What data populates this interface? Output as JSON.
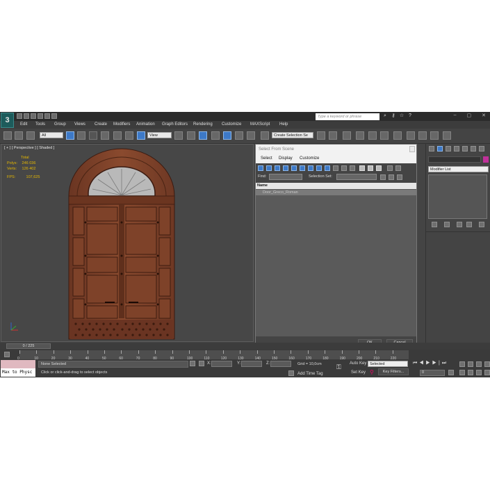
{
  "app": {
    "search_placeholder": "Type a keyword or phrase"
  },
  "menu": [
    "Edit",
    "Tools",
    "Group",
    "Views",
    "Create",
    "Modifiers",
    "Animation",
    "Graph Editors",
    "Rendering",
    "Customize",
    "MAXScript",
    "Help"
  ],
  "toolbar": {
    "filter_value": "All",
    "refcoord_value": "View",
    "selection_set_value": "Create Selection Se"
  },
  "viewport": {
    "label": "[ + ] [ Perspective ] [ Shaded ]",
    "stats": {
      "total_label": "Total",
      "polys_label": "Polys:",
      "polys_value": "246 036",
      "verts_label": "Verts:",
      "verts_value": "126 402",
      "fps_label": "FPS:",
      "fps_value": "107,625"
    }
  },
  "dialog": {
    "title": "Select From Scene",
    "menu": [
      "Select",
      "Display",
      "Customize"
    ],
    "find_label": "Find:",
    "selection_set_label": "Selection Set:",
    "column_name": "Name",
    "items": [
      "Door_Greco_Roman"
    ],
    "ok_label": "OK",
    "cancel_label": "Cancel"
  },
  "command_panel": {
    "modifier_list": "Modifier List"
  },
  "timeline": {
    "slider_text": "0 / 225",
    "ticks": [
      "0",
      "10",
      "20",
      "30",
      "40",
      "50",
      "60",
      "70",
      "80",
      "90",
      "100",
      "110",
      "120",
      "130",
      "140",
      "150",
      "160",
      "170",
      "180",
      "190",
      "200",
      "210",
      "220"
    ]
  },
  "status": {
    "script_text": "Max to Physc",
    "selection_status": "None Selected",
    "prompt": "Click or click-and-drag to select objects",
    "x_label": "X:",
    "y_label": "Y:",
    "z_label": "Z:",
    "grid": "Grid = 10,0cm",
    "add_time_tag": "Add Time Tag",
    "auto_key": "Auto Key",
    "auto_key_value": "Selected",
    "set_key": "Set Key",
    "key_filters": "Key Filters...",
    "frame_value": "0"
  },
  "colors": {
    "accent_blue": "#3d79c7",
    "door_wood": "#7a4129",
    "stats_yellow": "#e6b800"
  }
}
